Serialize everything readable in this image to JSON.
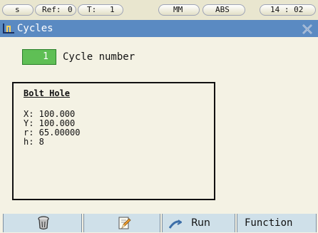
{
  "status_bar": {
    "mode": "s",
    "ref_label": "Ref:",
    "ref_value": "0",
    "tool_label": "T:",
    "tool_value": "1",
    "units": "MM",
    "position_mode": "ABS",
    "time": "14 : 02"
  },
  "titlebar": {
    "icon": "cycles-icon",
    "title": "Cycles",
    "close_icon": "close-icon"
  },
  "cycle": {
    "number_value": "1",
    "label": "Cycle number"
  },
  "panel": {
    "title": "Bolt Hole",
    "lines": [
      "X: 100.000",
      "Y: 100.000",
      "r: 65.00000",
      "h: 8"
    ]
  },
  "softkeys": {
    "key1_icon": "delete-icon",
    "key2_icon": "edit-icon",
    "run_icon": "run-icon",
    "run_label": "Run",
    "function_label": "Function"
  },
  "colors": {
    "titlebar": "#5a8ac2",
    "background": "#f4f2e4",
    "cycle_number_field": "#5fbf55",
    "softkey": "#cfe0e9"
  }
}
